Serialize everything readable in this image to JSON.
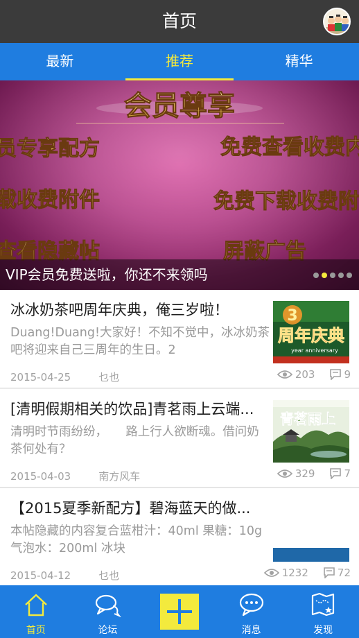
{
  "header": {
    "title": "首页"
  },
  "tabs": [
    {
      "label": "最新"
    },
    {
      "label": "推荐"
    },
    {
      "label": "精华"
    }
  ],
  "banner": {
    "caption": "VIP会员免费送啦，你还不来领吗",
    "art_text": {
      "heading": "会员尊享",
      "line1_left": "员专享配方",
      "line1_right": "免费查看收费内",
      "line2_left": "载收费附件",
      "line2_right": "免费下载收费附",
      "line3_left": "查看隐藏帖",
      "line3_right": "屏蔽广告"
    },
    "page_dots": 5,
    "active_dot": 1
  },
  "posts": [
    {
      "title": "冰冰奶茶吧周年庆典，俺三岁啦！",
      "excerpt": "Duang!Duang!大家好！不知不觉中，冰冰奶茶吧将迎来自己三周年的生日。2",
      "date": "2015-04-25",
      "author": "乜也",
      "views": "203",
      "comments": "9",
      "thumb": {
        "big_text": "周年庆典",
        "sub_text": "year anniversary",
        "num": "3"
      }
    },
    {
      "title": "[清明假期相关的饮品]青茗雨上云端...",
      "excerpt": "清明时节雨纷纷，　　路上行人欲断魂。借问奶茶何处有？",
      "date": "2015-04-03",
      "author": "南方风车",
      "views": "329",
      "comments": "7",
      "thumb": {
        "big_text": "青茗雨上"
      }
    },
    {
      "title": "【2015夏季新配方】碧海蓝天的做...",
      "excerpt": "本帖隐藏的内容复合蓝柑汁：40ml 果糖：10g 气泡水：200ml 冰块",
      "date": "2015-04-12",
      "author": "乜也",
      "views": "1232",
      "comments": "72"
    }
  ],
  "bottom_nav": {
    "home": "首页",
    "forum": "论坛",
    "messages": "消息",
    "discover": "发现"
  },
  "colors": {
    "header_bg": "#3b3b3b",
    "accent_blue": "#1f7de0",
    "accent_yellow": "#f3ea3d",
    "meta_gray": "#a2a2a2"
  }
}
